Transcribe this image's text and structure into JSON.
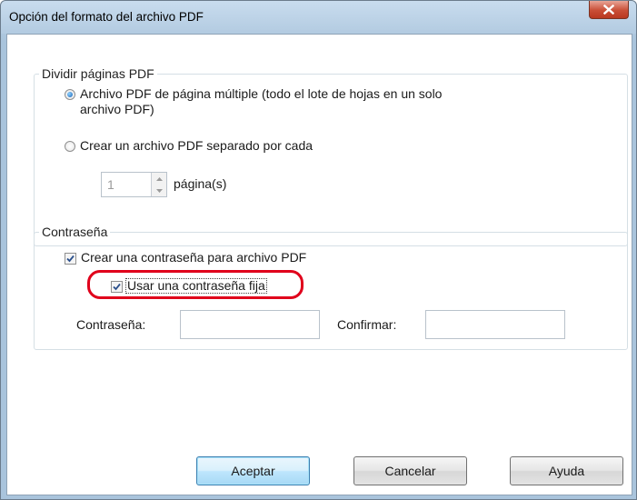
{
  "window": {
    "title": "Opción del formato del archivo PDF",
    "close_icon": "close-x-icon"
  },
  "split_pages": {
    "group_label": "Dividir páginas PDF",
    "option_multi_line1": "Archivo PDF de página múltiple (todo el lote de hojas en un solo",
    "option_multi_line2": "archivo PDF)",
    "option_multi_selected": true,
    "option_separate": "Crear un archivo PDF separado por cada",
    "option_separate_selected": false,
    "pages_value": "1",
    "pages_label": "página(s)"
  },
  "password": {
    "group_label": "Contraseña",
    "create_password_label": "Crear una contraseña para archivo PDF",
    "create_password_checked": true,
    "fixed_password_label": "Usar una contraseña fija",
    "fixed_password_checked": true,
    "password_field_label": "Contraseña:",
    "password_value": "",
    "confirm_field_label": "Confirmar:",
    "confirm_value": ""
  },
  "buttons": {
    "ok": "Aceptar",
    "cancel": "Cancelar",
    "help": "Ayuda"
  },
  "colors": {
    "highlight": "#e0001b",
    "close_button": "#c94e36"
  }
}
